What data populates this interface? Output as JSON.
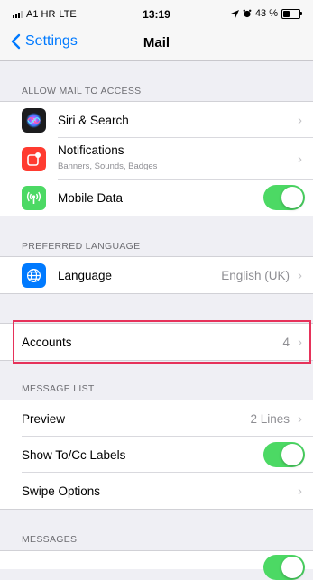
{
  "status_bar": {
    "carrier": "A1 HR",
    "network": "LTE",
    "time": "13:19",
    "battery_text": "43 %",
    "battery_level": 0.43
  },
  "nav": {
    "back_label": "Settings",
    "title": "Mail"
  },
  "sections": {
    "allow_access": {
      "header": "ALLOW MAIL TO ACCESS",
      "siri": "Siri & Search",
      "notifications": "Notifications",
      "notifications_sub": "Banners, Sounds, Badges",
      "mobile_data": "Mobile Data",
      "mobile_data_on": true
    },
    "preferred_language": {
      "header": "PREFERRED LANGUAGE",
      "language": "Language",
      "language_value": "English (UK)"
    },
    "accounts": {
      "label": "Accounts",
      "value": "4"
    },
    "message_list": {
      "header": "MESSAGE LIST",
      "preview": "Preview",
      "preview_value": "2 Lines",
      "show_to_cc": "Show To/Cc Labels",
      "show_to_cc_on": true,
      "swipe_options": "Swipe Options"
    },
    "messages": {
      "header": "MESSAGES"
    }
  },
  "colors": {
    "accent": "#007aff",
    "toggle_on": "#4cd964",
    "highlight": "#e6325a"
  },
  "icons": {
    "siri": "siri-icon",
    "notifications": "notifications-icon",
    "mobile_data": "antenna-icon",
    "language": "globe-icon",
    "back": "chevron-left-icon",
    "disclosure": "chevron-right-icon"
  }
}
